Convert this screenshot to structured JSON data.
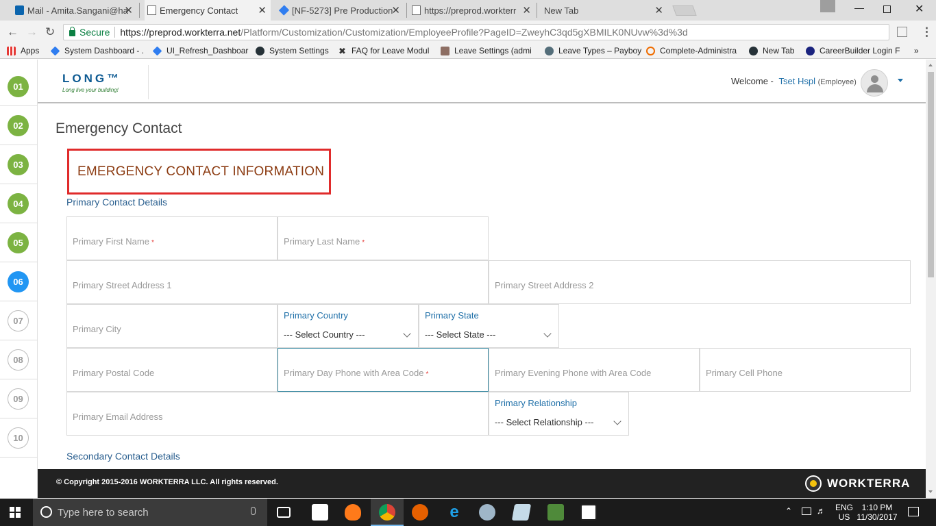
{
  "browser": {
    "tabs": [
      {
        "label": "Mail - Amita.Sangani@ha",
        "active": false
      },
      {
        "label": "Emergency Contact",
        "active": true
      },
      {
        "label": "[NF-5273] Pre Production",
        "active": false
      },
      {
        "label": "https://preprod.workterr",
        "active": false
      },
      {
        "label": "New Tab",
        "active": false
      }
    ],
    "close_glyph": "✕",
    "secure_label": "Secure",
    "url_host": "https://preprod.workterra.net",
    "url_path": "/Platform/Customization/Customization/EmployeeProfile?PageID=ZweyhC3qd5gXBMILK0NUvw%3d%3d",
    "bookmarks": [
      "Apps",
      "System Dashboard - .",
      "UI_Refresh_Dashboar",
      "System Settings",
      "FAQ for Leave Modul",
      "Leave Settings (admi",
      "Leave Types – Payboy",
      "Complete-Administra",
      "New Tab",
      "CareerBuilder Login F"
    ],
    "more_bookmarks": "»"
  },
  "steps": [
    {
      "num": "01",
      "state": "done"
    },
    {
      "num": "02",
      "state": "done"
    },
    {
      "num": "03",
      "state": "done"
    },
    {
      "num": "04",
      "state": "done"
    },
    {
      "num": "05",
      "state": "done"
    },
    {
      "num": "06",
      "state": "current"
    },
    {
      "num": "07",
      "state": "todo"
    },
    {
      "num": "08",
      "state": "todo"
    },
    {
      "num": "09",
      "state": "todo"
    },
    {
      "num": "10",
      "state": "todo"
    }
  ],
  "header": {
    "logo_text": "LONG™",
    "logo_tagline": "Long live your building!",
    "welcome_label": "Welcome -",
    "user_name": "Tset Hspl",
    "user_role": "(Employee)"
  },
  "page": {
    "title": "Emergency Contact",
    "section_title": "EMERGENCY CONTACT INFORMATION",
    "primary_heading": "Primary Contact Details",
    "secondary_heading": "Secondary Contact Details",
    "fields": {
      "first_name": "Primary First Name",
      "last_name": "Primary Last Name",
      "street1": "Primary Street Address 1",
      "street2": "Primary Street Address 2",
      "city": "Primary City",
      "country_label": "Primary Country",
      "country_value": "--- Select Country ---",
      "state_label": "Primary State",
      "state_value": "--- Select State ---",
      "postal": "Primary Postal Code",
      "day_phone": "Primary Day Phone with Area Code",
      "evening_phone": "Primary Evening Phone with Area Code",
      "cell_phone": "Primary Cell Phone",
      "email": "Primary Email Address",
      "relationship_label": "Primary Relationship",
      "relationship_value": "--- Select Relationship ---"
    },
    "required_mark": "*"
  },
  "footer": {
    "copyright": "© Copyright 2015-2016 WORKTERRA LLC. All rights reserved.",
    "brand": "WORKTERRA"
  },
  "taskbar": {
    "search_placeholder": "Type here to search",
    "lang_top": "ENG",
    "lang_bottom": "US",
    "time": "1:10 PM",
    "date": "11/30/2017"
  },
  "colors": {
    "step_done": "#7cb342",
    "step_current": "#2196f3",
    "section_border": "#e02b2b",
    "section_title": "#8b3a10",
    "link_blue": "#1e6fa8"
  }
}
